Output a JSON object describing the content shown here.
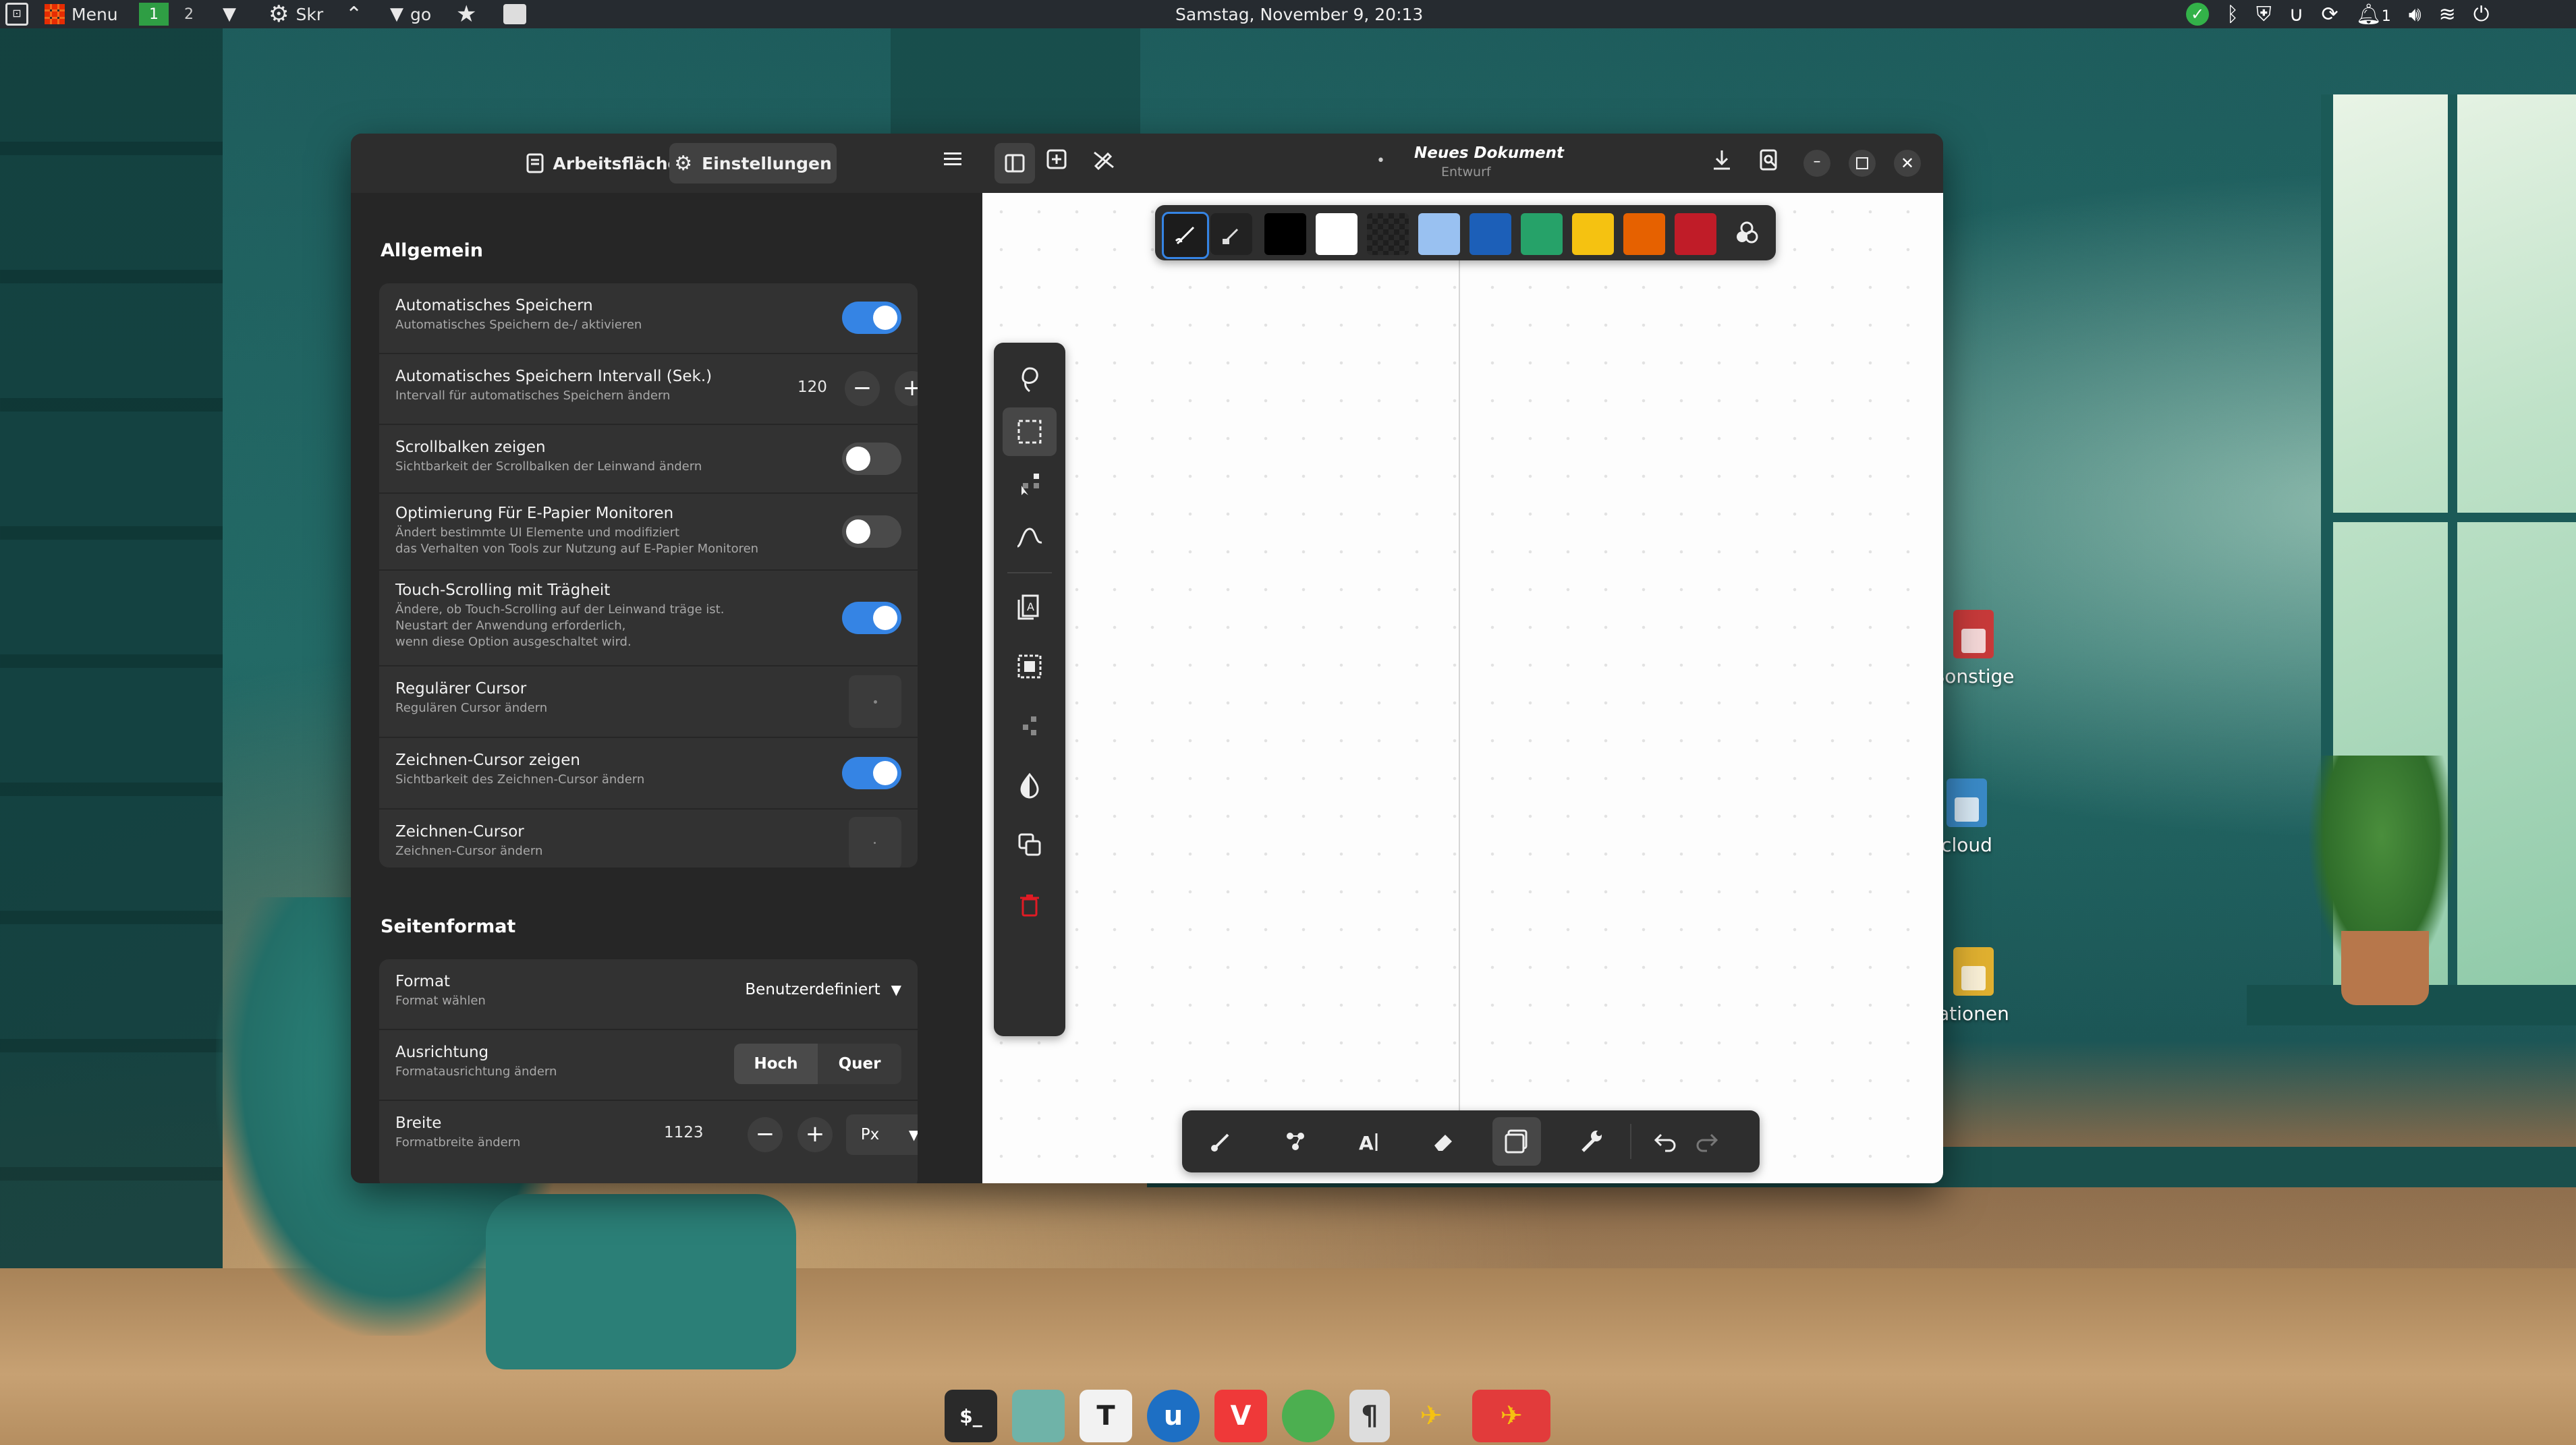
{
  "panel": {
    "menu_label": "Menu",
    "workspaces": [
      "1",
      "2"
    ],
    "launcher_skr": "Skr",
    "launcher_go": "go",
    "clock": "Samstag, November   9, 20:13",
    "notification_count": "1"
  },
  "desktop": {
    "icons": [
      {
        "label": "Sonstige",
        "color": "#c73a3a"
      },
      {
        "label": "cloud",
        "color": "#3a8ac7"
      },
      {
        "label": "ationen",
        "color": "#e0b030"
      }
    ]
  },
  "window": {
    "tab_workspace": "Arbeitsfläche",
    "tab_settings": "Einstellungen",
    "doc_title": "Neues Dokument",
    "doc_subtitle": "Entwurf",
    "unsaved_marker": "•"
  },
  "settings": {
    "general": {
      "title": "Allgemein",
      "autosave": {
        "title": "Automatisches Speichern",
        "subtitle": "Automatisches Speichern de-/ aktivieren",
        "enabled": true
      },
      "autosave_interval": {
        "title": "Automatisches Speichern Intervall (Sek.)",
        "subtitle": "Intervall für automatisches Speichern ändern",
        "value": "120"
      },
      "scrollbars": {
        "title": "Scrollbalken zeigen",
        "subtitle": "Sichtbarkeit der Scrollbalken der Leinwand ändern",
        "enabled": false
      },
      "epaper": {
        "title": "Optimierung Für E-Papier Monitoren",
        "subtitle_1": "Ändert bestimmte UI Elemente und modifiziert",
        "subtitle_2": "das Verhalten von Tools zur Nutzung auf E-Papier Monitoren",
        "enabled": false
      },
      "touch_scroll": {
        "title": "Touch-Scrolling mit Trägheit",
        "subtitle_1": "Ändere, ob Touch-Scrolling auf der Leinwand träge ist.",
        "subtitle_2": "Neustart der Anwendung erforderlich,",
        "subtitle_3": "wenn diese Option ausgeschaltet wird.",
        "enabled": true
      },
      "regular_cursor": {
        "title": "Regulärer Cursor",
        "subtitle": "Regulären Cursor ändern"
      },
      "draw_cursor_show": {
        "title": "Zeichnen-Cursor zeigen",
        "subtitle": "Sichtbarkeit des Zeichnen-Cursor ändern",
        "enabled": true
      },
      "draw_cursor": {
        "title": "Zeichnen-Cursor",
        "subtitle": "Zeichnen-Cursor ändern"
      }
    },
    "page_format": {
      "title": "Seitenformat",
      "format": {
        "title": "Format",
        "subtitle": "Format wählen",
        "value": "Benutzerdefiniert"
      },
      "orientation": {
        "title": "Ausrichtung",
        "subtitle": "Formatausrichtung ändern",
        "option_portrait": "Hoch",
        "option_landscape": "Quer",
        "selected": "Hoch"
      },
      "width": {
        "title": "Breite",
        "subtitle": "Formatbreite ändern",
        "value": "1123",
        "unit": "Px"
      }
    }
  },
  "palette": {
    "colors": [
      "#000000",
      "#ffffff",
      "#1e1e1e",
      "#99c1f1",
      "#1c5fb8",
      "#26a269",
      "#f5c211",
      "#e66100",
      "#c01c28"
    ]
  },
  "colors": {
    "accent": "#3584e4",
    "window_bg": "#2b2b2b",
    "panel_bg": "#262b30",
    "delete_red": "#e01b24"
  },
  "dock": {
    "apps": [
      "terminal-app",
      "files-app",
      "text-editor-app",
      "writer-app",
      "vivaldi-app",
      "spreadsheet-app",
      "notes-app",
      "rnote-app",
      "rnote-active-app"
    ]
  }
}
